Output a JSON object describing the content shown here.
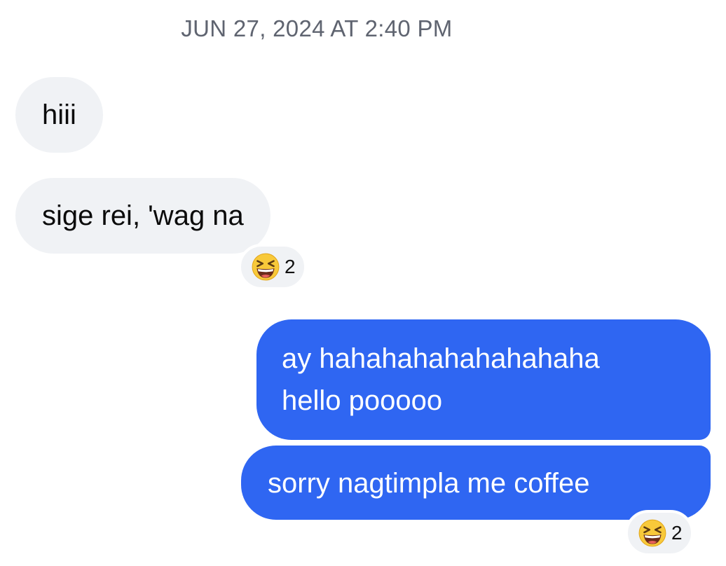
{
  "timestamp": "JUN 27, 2024 AT 2:40 PM",
  "messages": [
    {
      "direction": "incoming",
      "lines": [
        "hiii"
      ]
    },
    {
      "direction": "incoming",
      "lines": [
        "sige rei, 'wag na"
      ],
      "reaction": {
        "icon": "grinning-squinting-face-icon",
        "count": "2"
      }
    },
    {
      "direction": "outgoing",
      "lines": [
        "ay hahahahahahahahaha",
        "hello pooooo"
      ]
    },
    {
      "direction": "outgoing",
      "lines": [
        "sorry nagtimpla me coffee"
      ],
      "reaction": {
        "icon": "grinning-squinting-face-icon",
        "count": "2"
      }
    }
  ],
  "colors": {
    "incoming_bubble": "#f0f2f5",
    "outgoing_bubble": "#2f66f2",
    "timestamp_text": "#5f6470"
  }
}
